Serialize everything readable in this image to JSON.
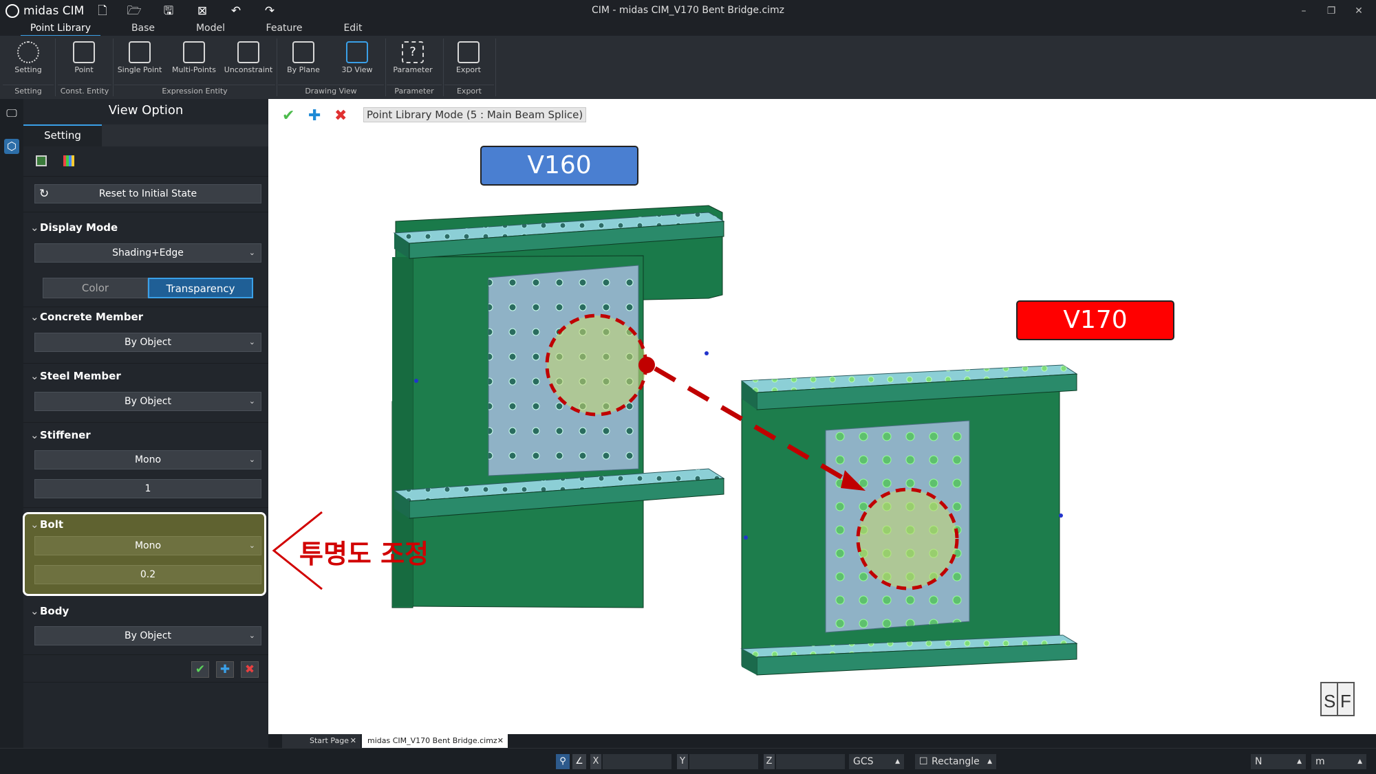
{
  "app": {
    "brand": "midas CIM",
    "window_title": "CIM - midas CIM_V170 Bent Bridge.cimz",
    "window_controls": [
      "–",
      "❐",
      "✕"
    ]
  },
  "menu_tabs": [
    {
      "label": "Point Library",
      "active": true
    },
    {
      "label": "Base",
      "active": false
    },
    {
      "label": "Model",
      "active": false
    },
    {
      "label": "Feature",
      "active": false
    },
    {
      "label": "Edit",
      "active": false
    }
  ],
  "ribbon": {
    "buttons": [
      {
        "label": "Setting",
        "icon": "gear-icon"
      },
      {
        "label": "Point",
        "icon": "point-icon"
      },
      {
        "label": "Single Point",
        "icon": "single-point-icon"
      },
      {
        "label": "Multi-Points",
        "icon": "multi-points-icon"
      },
      {
        "label": "Unconstraint",
        "icon": "unconstraint-icon"
      },
      {
        "label": "By Plane",
        "icon": "by-plane-icon"
      },
      {
        "label": "3D View",
        "icon": "3d-view-icon"
      },
      {
        "label": "Parameter",
        "icon": "parameter-icon"
      },
      {
        "label": "Export",
        "icon": "export-icon"
      }
    ],
    "groups": [
      "Setting",
      "Const. Entity",
      "Expression Entity",
      "Drawing View",
      "Parameter",
      "Export"
    ]
  },
  "panel": {
    "title": "View Option",
    "tab": "Setting",
    "reset_label": "Reset to Initial State",
    "display_mode": {
      "header": "Display Mode",
      "value": "Shading+Edge"
    },
    "segments": {
      "color": "Color",
      "transparency": "Transparency",
      "active": "Transparency"
    },
    "concrete": {
      "header": "Concrete Member",
      "value": "By Object"
    },
    "steel": {
      "header": "Steel Member",
      "value": "By Object"
    },
    "stiffener": {
      "header": "Stiffener",
      "value": "Mono",
      "number": "1"
    },
    "bolt": {
      "header": "Bolt",
      "value": "Mono",
      "number": "0.2"
    },
    "body": {
      "header": "Body",
      "value": "By Object"
    }
  },
  "viewport": {
    "mode_label": "Point Library Mode (5 : Main Beam Splice)",
    "tag_left": "V160",
    "tag_right": "V170",
    "annotation": "투명도 조정",
    "colors": {
      "tag_left": "#4a7fd1",
      "tag_right": "#ff0000",
      "web": "#1a7a4a",
      "plate": "#8fb2c6",
      "flange": "#8ccfd6"
    }
  },
  "doc_tabs": [
    {
      "label": "Start Page",
      "active": false
    },
    {
      "label": "midas CIM_V170 Bent Bridge.cimz",
      "active": true
    }
  ],
  "status": {
    "x_label": "X",
    "y_label": "Y",
    "z_label": "Z",
    "coord_system": "GCS",
    "selection": "Rectangle",
    "force_unit": "N",
    "length_unit": "m"
  }
}
